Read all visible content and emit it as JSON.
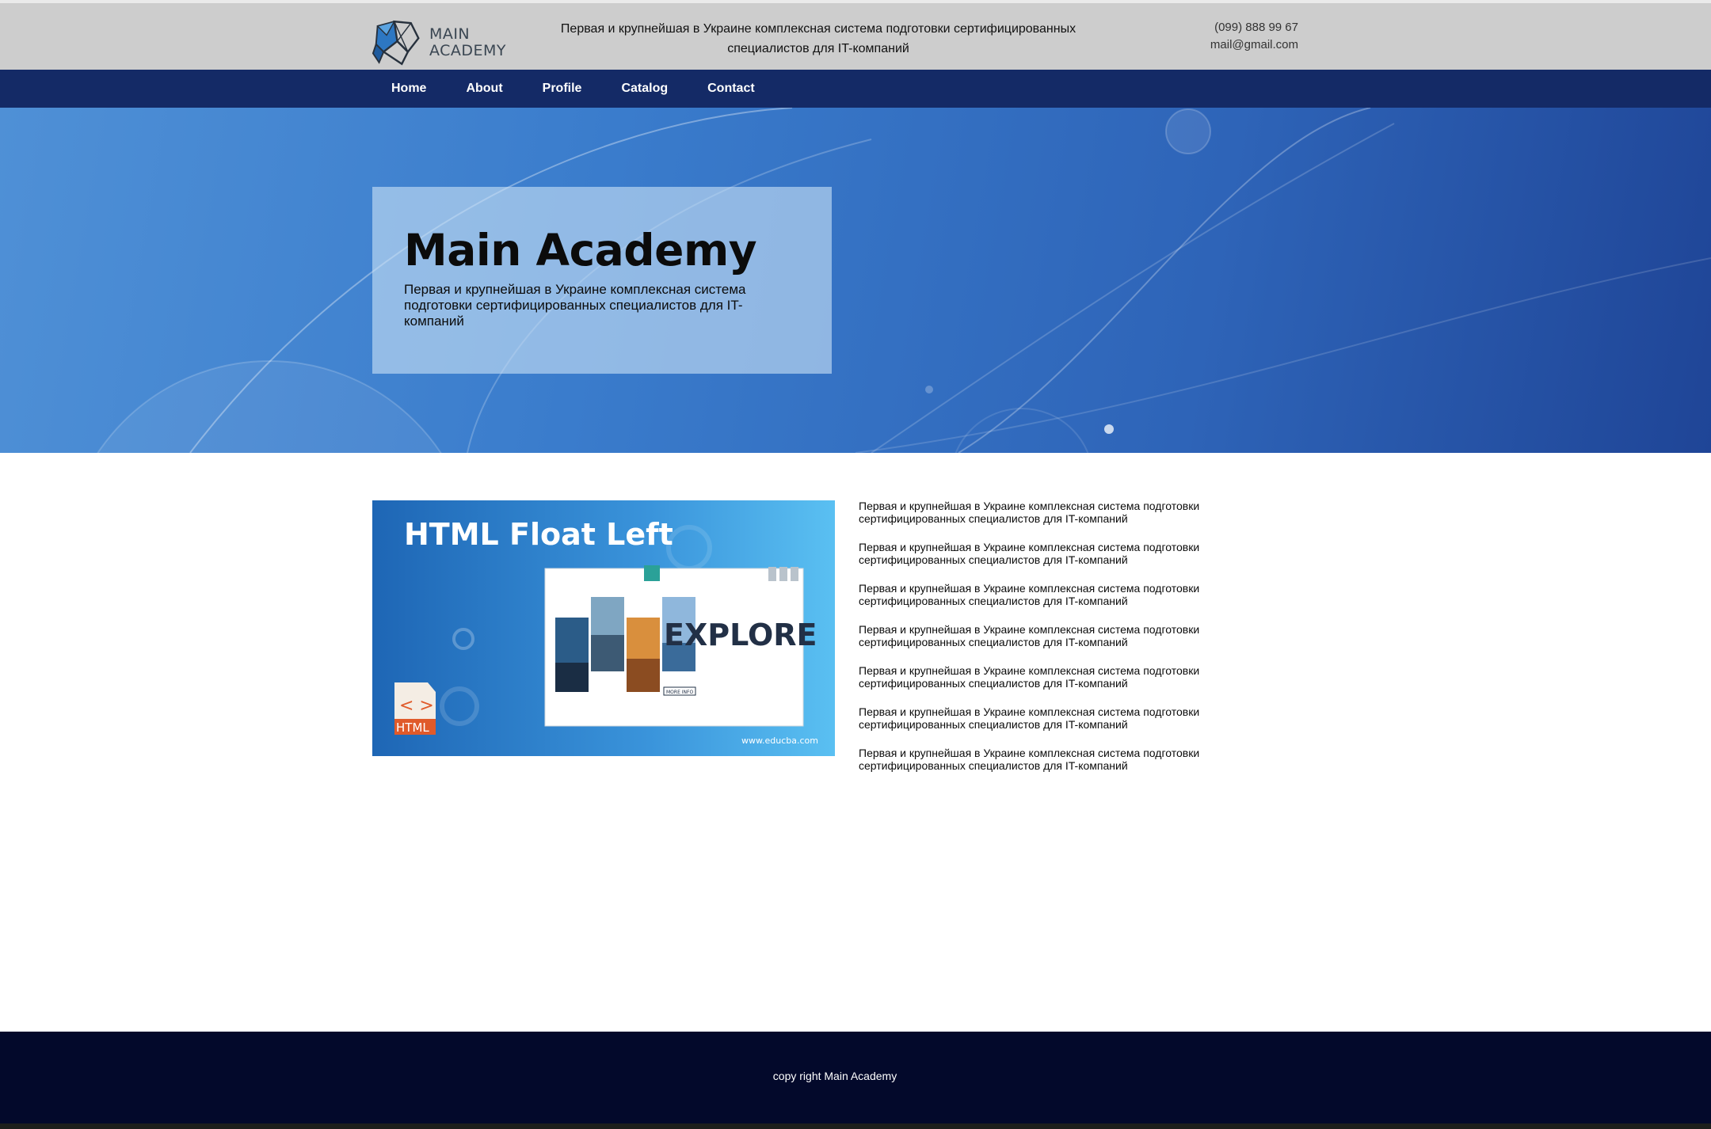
{
  "header": {
    "logo_line1": "MAIN",
    "logo_line2": "ACADEMY",
    "tagline": "Первая и крупнейшая в Украине комплексная система подготовки сертифицированных специалистов для IT-компаний",
    "phone": "(099) 888 99 67",
    "email": "mail@gmail.com"
  },
  "nav": {
    "items": [
      {
        "label": "Home"
      },
      {
        "label": "About"
      },
      {
        "label": "Profile"
      },
      {
        "label": "Catalog"
      },
      {
        "label": "Contact"
      }
    ]
  },
  "hero": {
    "title": "Main Academy",
    "subtitle": "Первая и крупнейшая в Украине комплексная система подготовки сертифицированных специалистов для IT-компаний"
  },
  "feature_image": {
    "heading": "HTML Float Left",
    "explore_word": "EXPLORE",
    "badge": "HTML",
    "site": "www.educba.com",
    "more_button": "MORE INFO"
  },
  "paragraphs": [
    "Первая и крупнейшая в Украине комплексная система подготовки сертифицированных специалистов для IT-компаний",
    "Первая и крупнейшая в Украине комплексная система подготовки сертифицированных специалистов для IT-компаний",
    "Первая и крупнейшая в Украине комплексная система подготовки сертифицированных специалистов для IT-компаний",
    "Первая и крупнейшая в Украине комплексная система подготовки сертифицированных специалистов для IT-компаний",
    "Первая и крупнейшая в Украине комплексная система подготовки сертифицированных специалистов для IT-компаний",
    "Первая и крупнейшая в Украине комплексная система подготовки сертифицированных специалистов для IT-компаний",
    "Первая и крупнейшая в Украине комплексная система подготовки сертифицированных специалистов для IT-компаний"
  ],
  "footer": {
    "copyright": "copy right Main Academy"
  },
  "colors": {
    "header_bg": "#cdcdcd",
    "nav_bg": "#142a66",
    "hero_start": "#4f90d6",
    "hero_end": "#1f4597",
    "footer_bg": "#03092b"
  }
}
